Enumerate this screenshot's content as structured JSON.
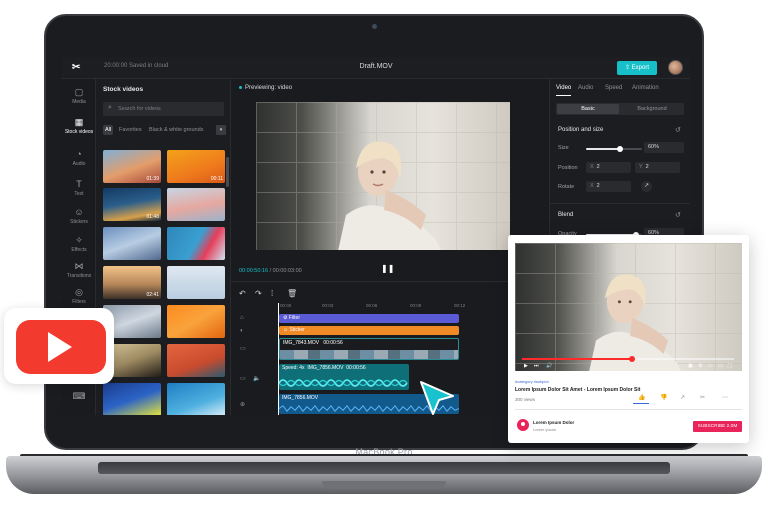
{
  "app": {
    "top_status": "20:00:00 Saved in cloud",
    "file_title": "Draft.MOV",
    "export_label": "Export"
  },
  "rail": [
    {
      "label": "Media",
      "icon": "▢",
      "icon_name": "media-icon"
    },
    {
      "label": "Stock videos",
      "icon": "▦",
      "icon_name": "stock-videos-icon"
    },
    {
      "label": "Audio",
      "icon": "◔",
      "icon_name": "audio-icon"
    },
    {
      "label": "Text",
      "icon": "T",
      "icon_name": "text-icon"
    },
    {
      "label": "Stickers",
      "icon": "☺",
      "icon_name": "stickers-icon"
    },
    {
      "label": "Effects",
      "icon": "✧",
      "icon_name": "effects-icon"
    },
    {
      "label": "Transitions",
      "icon": "⋈",
      "icon_name": "transitions-icon"
    },
    {
      "label": "Filters",
      "icon": "◎",
      "icon_name": "filters-icon"
    }
  ],
  "stock": {
    "title": "Stock videos",
    "search_placeholder": "Search for videos",
    "filters": [
      "All",
      "Favorites",
      "Black & white grounds"
    ],
    "thumbs": [
      {
        "duration": "01:39"
      },
      {
        "duration": "00:11"
      },
      {
        "duration": "01:48"
      },
      {
        "duration": ""
      },
      {
        "duration": ""
      },
      {
        "duration": ""
      },
      {
        "duration": "02:41"
      },
      {
        "duration": ""
      },
      {
        "duration": ""
      },
      {
        "duration": ""
      },
      {
        "duration": ""
      },
      {
        "duration": ""
      },
      {
        "duration": ""
      },
      {
        "duration": ""
      }
    ]
  },
  "preview": {
    "label": "Previewing: video",
    "time_current": "00:00:50:16",
    "time_total": " / 00:00:03:00"
  },
  "props": {
    "tabs": [
      "Video",
      "Audio",
      "Speed",
      "Animation"
    ],
    "segments": [
      "Basic",
      "Background"
    ],
    "position_title": "Position and size",
    "size_label": "Size",
    "size_value": "60%",
    "size_fraction": 0.6,
    "position_label": "Position",
    "pos_x_axis": "X",
    "pos_x": "2",
    "pos_y_axis": "Y",
    "pos_y": "2",
    "rotate_label": "Rotate",
    "rotate_axis": "X",
    "rotate_value": "2",
    "blend_title": "Blend",
    "opacity_label": "Opacity",
    "opacity_value": "60%",
    "opacity_fraction": 0.9
  },
  "timeline": {
    "ticks": [
      "00:00",
      "00:03",
      "00:06",
      "00:09",
      "00:12"
    ],
    "filter_label": "Filter",
    "sticker_label": "Sticker",
    "clip1_name": "IMG_7843.MOV",
    "clip1_dur": "00:00:56",
    "clip2_speed": "Speed: 4x",
    "clip2_name": "IMG_7856.MOV",
    "clip2_dur": "00:00:56",
    "clip3_name": "IMG_7856.MOV"
  },
  "youtube": {
    "tags": "#category   #subject",
    "title": "Lorem Ipsum Dolor Sit Amet - Lorem Ipsum Dolor Sit",
    "views": "300 views",
    "channel_name": "Lorem Ipsum Dolor",
    "channel_sub": "Lorem ipsum",
    "subscribe_label": "SUBSCRIBE 2.0M",
    "progress_fraction": 0.52
  },
  "laptop": {
    "brand": "MacBook Pro"
  },
  "colors": {
    "accent": "#17c0c9",
    "youtube_red": "#f23a2e",
    "subscribe": "#e8245a",
    "filter_clip": "#5b5bd6",
    "sticker_clip": "#f08a26"
  }
}
